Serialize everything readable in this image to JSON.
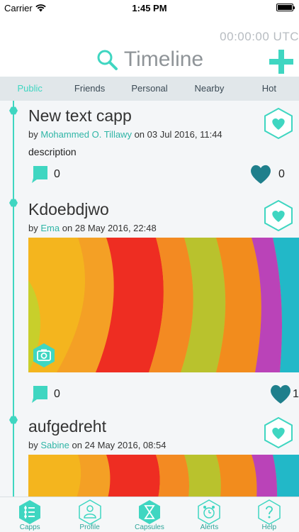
{
  "status_bar": {
    "carrier": "Carrier",
    "time": "1:45 PM"
  },
  "header": {
    "clock": "00:00:00 UTC",
    "title": "Timeline"
  },
  "tabs": [
    {
      "label": "Public",
      "active": true
    },
    {
      "label": "Friends",
      "active": false
    },
    {
      "label": "Personal",
      "active": false
    },
    {
      "label": "Nearby",
      "active": false
    },
    {
      "label": "Hot",
      "active": false
    }
  ],
  "posts": [
    {
      "title": "New text capp",
      "by": "by",
      "author": "Mohammed O. Tillawy",
      "date": "on 03 Jul 2016, 11:44",
      "description": "description",
      "comments": "0",
      "likes": "0",
      "has_photo": false
    },
    {
      "title": "Kdoebdjwo",
      "by": "by",
      "author": "Ema",
      "date": "on 28 May 2016, 22:48",
      "comments": "0",
      "likes": "1",
      "has_photo": true
    },
    {
      "title": "aufgedreht",
      "by": "by",
      "author": "Sabine",
      "date": "on 24 May 2016, 08:54",
      "has_photo": true
    }
  ],
  "bottom_nav": [
    {
      "label": "Capps",
      "icon": "capps-icon",
      "active": true
    },
    {
      "label": "Profile",
      "icon": "profile-icon",
      "active": false
    },
    {
      "label": "Capsules",
      "icon": "capsules-icon",
      "active": true
    },
    {
      "label": "Alerts",
      "icon": "alerts-icon",
      "active": false
    },
    {
      "label": "Help",
      "icon": "help-icon",
      "active": false
    }
  ],
  "colors": {
    "accent": "#3fd6c1",
    "heart_dark": "#1f7f8c",
    "tab_bg": "#e1e7ea",
    "muted": "#8f9498"
  }
}
